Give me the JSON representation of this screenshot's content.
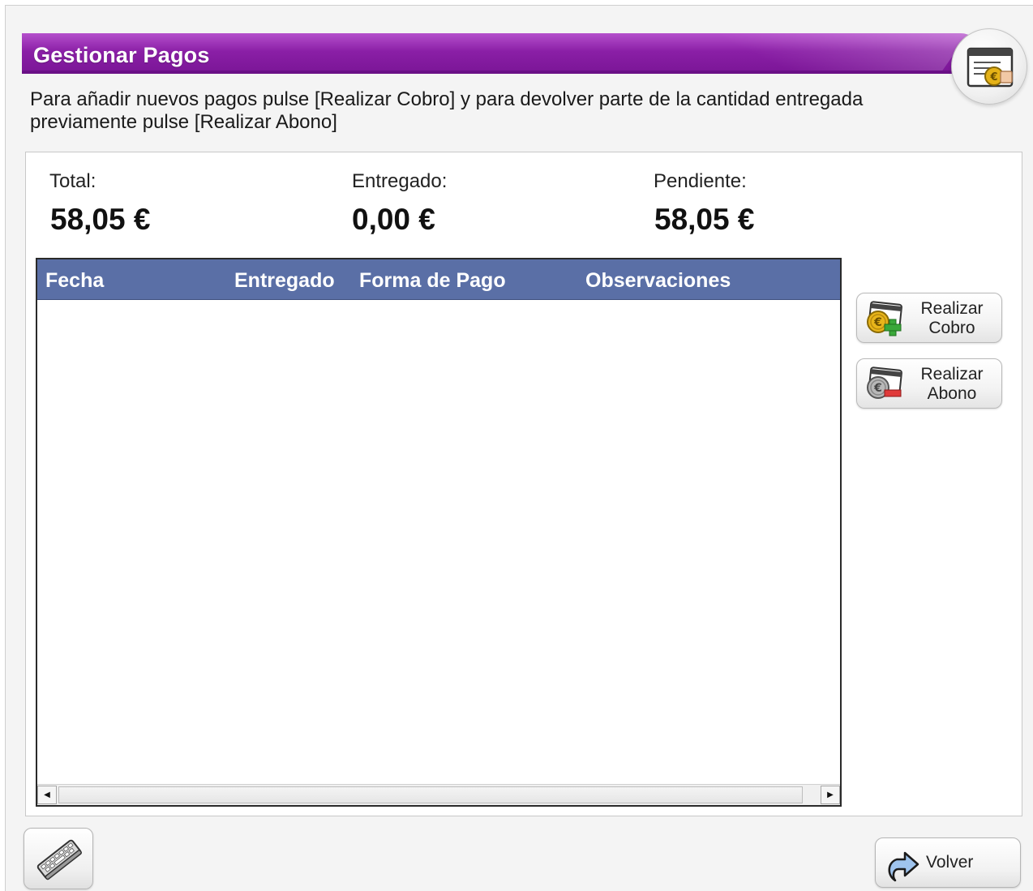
{
  "header": {
    "title": "Gestionar Pagos",
    "icon": "payment-card-icon",
    "accent_color": "#8a1fa6"
  },
  "instructions": "Para añadir nuevos pagos pulse [Realizar Cobro] y para devolver parte de la cantidad entregada previamente pulse [Realizar Abono]",
  "summary": {
    "total_label": "Total:",
    "total_value": "58,05 €",
    "entregado_label": "Entregado:",
    "entregado_value": "0,00 €",
    "pendiente_label": "Pendiente:",
    "pendiente_value": "58,05 €"
  },
  "table": {
    "header_color": "#5a6fa6",
    "columns": [
      "Fecha",
      "Entregado",
      "Forma de Pago",
      "Observaciones"
    ],
    "rows": []
  },
  "actions": {
    "cobro_label": "Realizar Cobro",
    "cobro_line1": "Realizar",
    "cobro_line2": "Cobro",
    "cobro_icon": "euro-coin-plus-icon",
    "abono_line1": "Realizar",
    "abono_line2": "Abono",
    "abono_icon": "euro-coin-minus-icon"
  },
  "footer": {
    "keyboard_icon": "keyboard-icon",
    "volver_label": "Volver",
    "volver_icon": "return-arrow-icon"
  }
}
